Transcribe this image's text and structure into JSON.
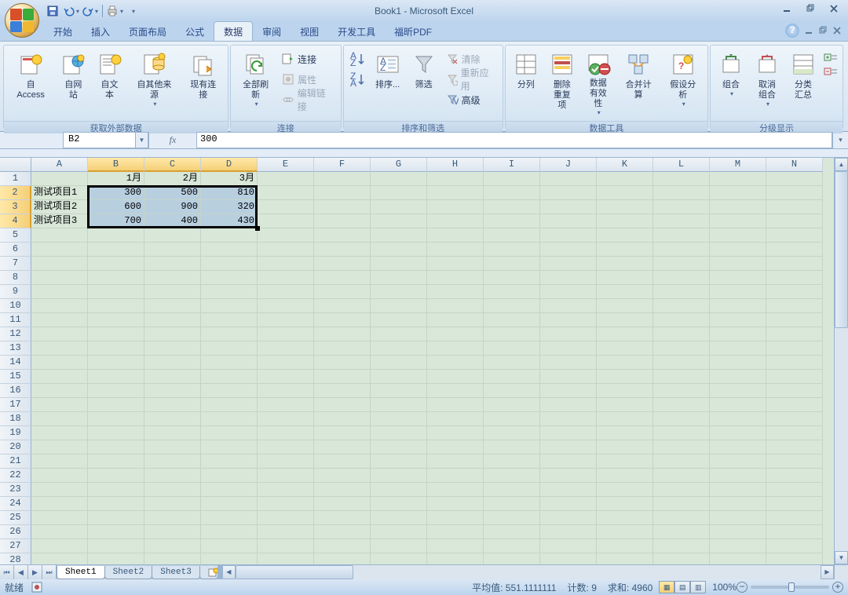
{
  "title": "Book1 - Microsoft Excel",
  "qat": {
    "save": "保存",
    "undo": "撤销",
    "redo": "恢复"
  },
  "tabs": {
    "home": "开始",
    "insert": "插入",
    "layout": "页面布局",
    "formula": "公式",
    "data": "数据",
    "review": "审阅",
    "view": "视图",
    "dev": "开发工具",
    "foxit": "福昕PDF"
  },
  "ribbon": {
    "ext_data": {
      "label": "获取外部数据",
      "access": "自 Access",
      "web": "自网站",
      "text": "自文本",
      "other": "自其他来源",
      "existing": "现有连接"
    },
    "connections": {
      "label": "连接",
      "refresh": "全部刷新",
      "conn": "连接",
      "props": "属性",
      "edit": "编辑链接"
    },
    "sort_filter": {
      "label": "排序和筛选",
      "sort": "排序...",
      "filter": "筛选",
      "clear": "清除",
      "reapply": "重新应用",
      "advanced": "高级"
    },
    "data_tools": {
      "label": "数据工具",
      "text_to_col": "分列",
      "remove_dup": "删除\n重复项",
      "validation": "数据\n有效性",
      "consolidate": "合并计算",
      "whatif": "假设分析"
    },
    "outline": {
      "label": "分级显示",
      "group": "组合",
      "ungroup": "取消组合",
      "subtotal": "分类汇总"
    }
  },
  "namebox": "B2",
  "formula": "300",
  "columns": [
    "A",
    "B",
    "C",
    "D",
    "E",
    "F",
    "G",
    "H",
    "I",
    "J",
    "K",
    "L",
    "M",
    "N"
  ],
  "rows": 28,
  "selected_cols": [
    1,
    2,
    3
  ],
  "selected_rows": [
    1,
    2,
    3
  ],
  "data": {
    "headers": [
      "1月",
      "2月",
      "3月"
    ],
    "row_labels": [
      "测试项目1",
      "测试项目2",
      "测试项目3"
    ],
    "values": [
      [
        300,
        500,
        810
      ],
      [
        600,
        900,
        320
      ],
      [
        700,
        400,
        430
      ]
    ]
  },
  "sheet_tabs": [
    "Sheet1",
    "Sheet2",
    "Sheet3"
  ],
  "active_sheet": 0,
  "status": {
    "ready": "就绪",
    "avg_label": "平均值:",
    "avg": "551.1111111",
    "count_label": "计数:",
    "count": "9",
    "sum_label": "求和:",
    "sum": "4960",
    "zoom": "100%"
  },
  "chart_data": {
    "type": "table",
    "categories": [
      "1月",
      "2月",
      "3月"
    ],
    "series": [
      {
        "name": "测试项目1",
        "values": [
          300,
          500,
          810
        ]
      },
      {
        "name": "测试项目2",
        "values": [
          600,
          900,
          320
        ]
      },
      {
        "name": "测试项目3",
        "values": [
          700,
          400,
          430
        ]
      }
    ]
  }
}
